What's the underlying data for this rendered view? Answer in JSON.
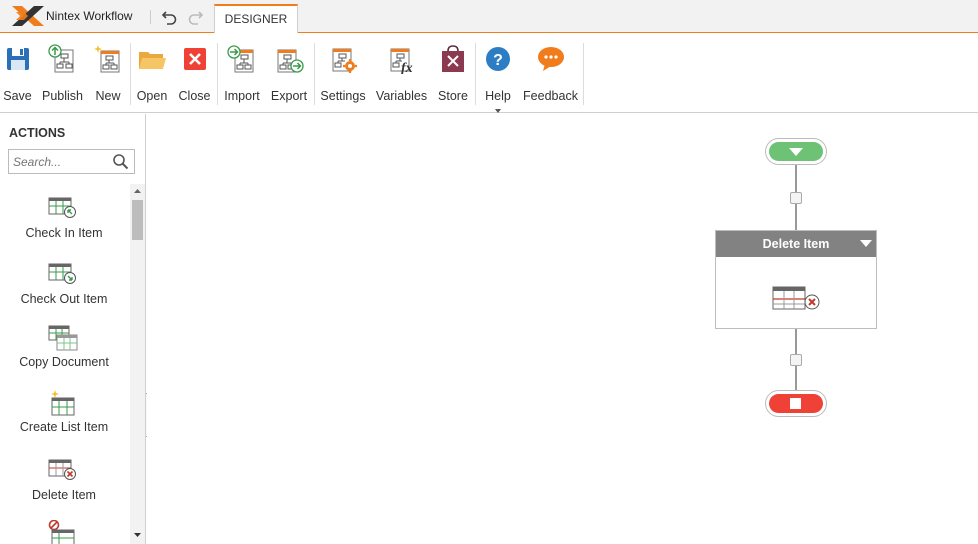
{
  "app": {
    "brand": "Nintex Workflow",
    "active_tab": "DESIGNER"
  },
  "ribbon": {
    "save": "Save",
    "publish": "Publish",
    "new": "New",
    "open": "Open",
    "close": "Close",
    "import": "Import",
    "export": "Export",
    "settings": "Settings",
    "variables": "Variables",
    "store": "Store",
    "help": "Help",
    "feedback": "Feedback"
  },
  "sidebar": {
    "title": "ACTIONS",
    "search_placeholder": "Search...",
    "items": [
      {
        "label": "Check In Item"
      },
      {
        "label": "Check Out Item"
      },
      {
        "label": "Copy Document"
      },
      {
        "label": "Create List Item"
      },
      {
        "label": "Delete Item"
      }
    ]
  },
  "canvas": {
    "action_title": "Delete Item"
  },
  "colors": {
    "accent": "#f07c1c",
    "start": "#6dc275",
    "end": "#ef4136",
    "action_header": "#828282",
    "help_blue": "#2d7dc4",
    "feedback_orange": "#f07c1c"
  }
}
